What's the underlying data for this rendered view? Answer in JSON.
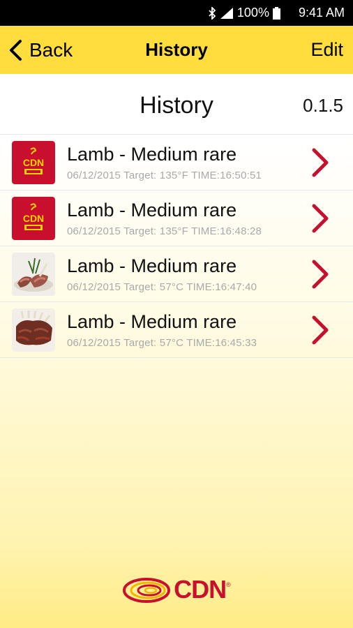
{
  "status_bar": {
    "battery": "100%",
    "time": "9:41 AM",
    "icons": [
      "bluetooth-icon",
      "signal-icon",
      "battery-icon"
    ]
  },
  "nav": {
    "back_label": "Back",
    "title": "History",
    "edit_label": "Edit"
  },
  "header": {
    "title": "History",
    "version": "0.1.5"
  },
  "items": [
    {
      "title": "Lamb - Medium rare",
      "subtitle": "06/12/2015 Target: 135°F TIME:16:50:51",
      "thumb": "cdn-logo-thumb"
    },
    {
      "title": "Lamb - Medium rare",
      "subtitle": "06/12/2015 Target: 135°F TIME:16:48:28",
      "thumb": "cdn-logo-thumb"
    },
    {
      "title": "Lamb - Medium rare",
      "subtitle": "06/12/2015 Target: 57°C TIME:16:47:40",
      "thumb": "lamb-photo-thumb"
    },
    {
      "title": "Lamb - Medium rare",
      "subtitle": "06/12/2015 Target: 57°C TIME:16:45:33",
      "thumb": "lamb-chops-photo-thumb"
    }
  ],
  "footer": {
    "logo_text": "CDN",
    "logo_reg": "®"
  },
  "colors": {
    "nav_bg": "#fedd3c",
    "accent_red": "#c8102e",
    "chevron": "#c8102e"
  }
}
